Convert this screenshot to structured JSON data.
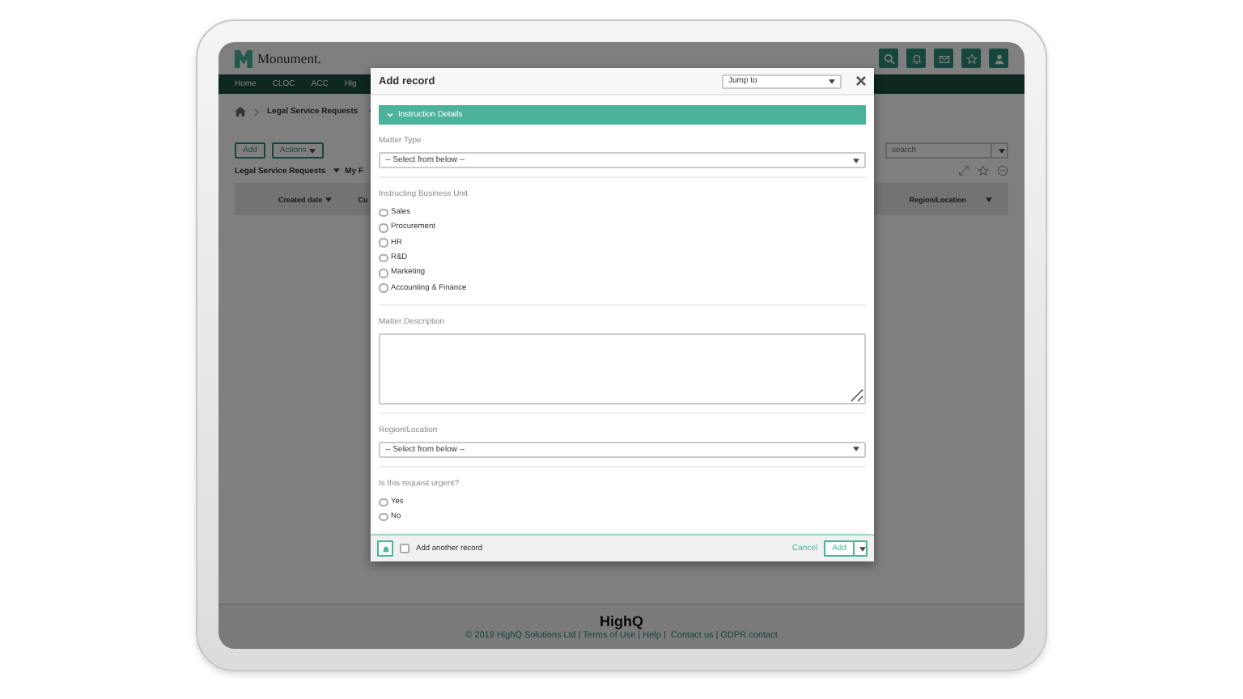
{
  "app": {
    "logo": "Monument.",
    "nav": [
      "Home",
      "CLOC",
      "ACC",
      "Hig"
    ],
    "breadcrumb": "Legal Service Requests",
    "toolbar": [
      "Add",
      "Actions"
    ],
    "view": {
      "title": "Legal Service Requests",
      "other": "My F"
    },
    "search": {
      "placeholder": "search"
    },
    "table": {
      "columns": [
        "Created date",
        "Cu",
        "Region/Location"
      ]
    },
    "footer": {
      "logo": "HighQ",
      "text": "© 2019 HighQ Solutions Ltd | Terms of Use | Help |  Contact us | GDPR contact"
    }
  },
  "modal": {
    "title": "Add record",
    "jump": "Jump to",
    "section": {
      "title": "Instruction Details",
      "expanded": true
    },
    "fields": [
      {
        "kind": "select",
        "label": "Matter Type",
        "value": "-- Select from below --"
      },
      {
        "kind": "radio",
        "label": "Instructing Business Unit",
        "options": [
          {
            "label": "Sales",
            "selected": false
          },
          {
            "label": "Procurement",
            "selected": false
          },
          {
            "label": "HR",
            "selected": false
          },
          {
            "label": "R&D",
            "selected": false
          },
          {
            "label": "Marketing",
            "selected": false
          },
          {
            "label": "Accounting & Finance",
            "selected": false
          }
        ]
      },
      {
        "kind": "textarea",
        "label": "Matter Description"
      },
      {
        "kind": "select",
        "label": "Region/Location",
        "value": "-- Select from below --"
      },
      {
        "kind": "radio",
        "label": "Is this request urgent?",
        "options": [
          {
            "label": "Yes",
            "selected": false
          },
          {
            "label": "No",
            "selected": false
          }
        ]
      }
    ],
    "add_another": {
      "label": "Add another record",
      "checked": false
    },
    "cancel": "Cancel",
    "add": "Add"
  }
}
